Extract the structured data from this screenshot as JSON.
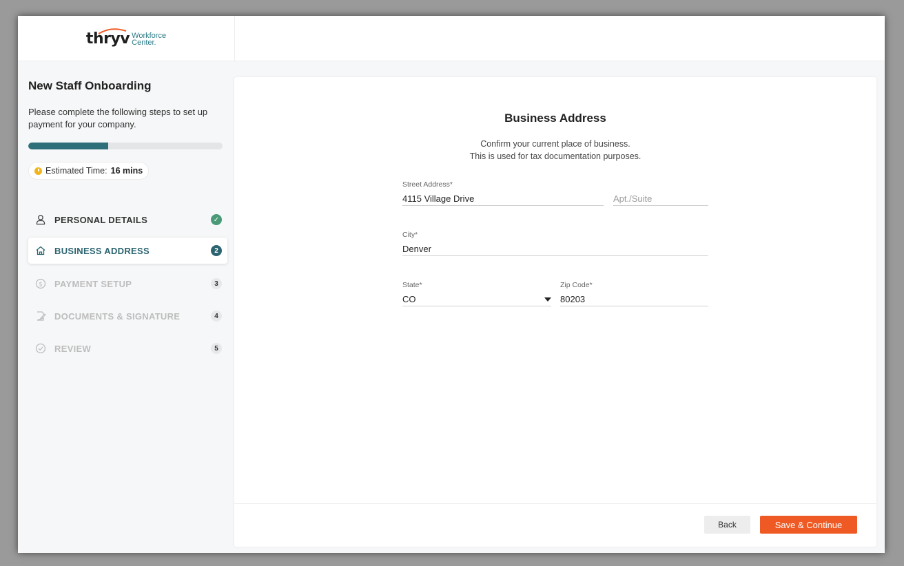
{
  "brand": {
    "name": "thryv",
    "sub_line1": "Workforce",
    "sub_line2": "Center."
  },
  "sidebar": {
    "title": "New Staff Onboarding",
    "description": "Please complete the following steps to set up payment for your company.",
    "progress_fraction": 0.41,
    "estimate_label": "Estimated Time:",
    "estimate_value": "16 mins",
    "steps": [
      {
        "label": "PERSONAL DETAILS",
        "icon": "user-icon",
        "badge": "✓",
        "state": "done"
      },
      {
        "label": "BUSINESS ADDRESS",
        "icon": "home-icon",
        "badge": "2",
        "state": "active"
      },
      {
        "label": "PAYMENT SETUP",
        "icon": "dollar-icon",
        "badge": "3",
        "state": "pending"
      },
      {
        "label": "DOCUMENTS & SIGNATURE",
        "icon": "document-sign-icon",
        "badge": "4",
        "state": "pending"
      },
      {
        "label": "REVIEW",
        "icon": "check-circle-icon",
        "badge": "5",
        "state": "pending"
      }
    ]
  },
  "form": {
    "title": "Business Address",
    "subtitle_line1": "Confirm your current place of business.",
    "subtitle_line2": "This is used for tax documentation purposes.",
    "street": {
      "label": "Street Address*",
      "value": "4115 Village Drive"
    },
    "apt": {
      "placeholder": "Apt./Suite",
      "value": ""
    },
    "city": {
      "label": "City*",
      "value": "Denver"
    },
    "state": {
      "label": "State*",
      "value": "CO"
    },
    "zip": {
      "label": "Zip Code*",
      "value": "80203"
    }
  },
  "actions": {
    "back": "Back",
    "save": "Save & Continue"
  },
  "colors": {
    "accent": "#2c6470",
    "primary_button": "#ef5a24",
    "done": "#4a9a78",
    "clock": "#f2b418"
  }
}
